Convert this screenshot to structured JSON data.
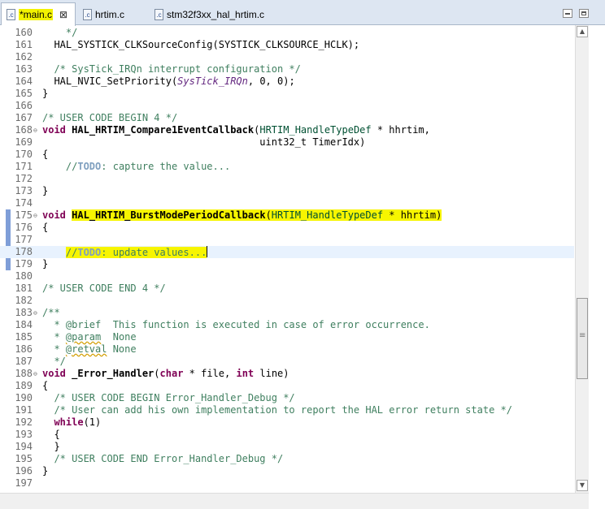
{
  "tabs": [
    {
      "label": "*main.c",
      "icon": "c-file-icon",
      "active": true
    },
    {
      "label": "hrtim.c",
      "icon": "c-file-icon",
      "active": false
    },
    {
      "label": "stm32f3xx_hal_hrtim.c",
      "icon": "c-file-icon",
      "active": false
    }
  ],
  "icon_text": ".c",
  "close_glyph": "⊠",
  "window_controls": [
    "minimize-icon",
    "maximize-icon"
  ],
  "scroll": {
    "up": "▲",
    "down": "▼",
    "thumb_fraction": 0.72
  },
  "colors": {
    "keyword": "#7f0055",
    "comment": "#3f7f5f",
    "highlight": "#f7f500",
    "current_line": "#e8f2fe",
    "change_bar": "#7f9ed8"
  },
  "editor": {
    "lines": [
      {
        "n": "160",
        "fold": "",
        "text": "    */"
      },
      {
        "n": "161",
        "fold": "",
        "text": "  HAL_SYSTICK_CLKSourceConfig(SYSTICK_CLKSOURCE_HCLK);"
      },
      {
        "n": "162",
        "fold": "",
        "text": ""
      },
      {
        "n": "163",
        "fold": "",
        "text": "  /* SysTick_IRQn interrupt configuration */"
      },
      {
        "n": "164",
        "fold": "",
        "text": "  HAL_NVIC_SetPriority(SysTick_IRQn, 0, 0);"
      },
      {
        "n": "165",
        "fold": "",
        "text": "}"
      },
      {
        "n": "166",
        "fold": "",
        "text": ""
      },
      {
        "n": "167",
        "fold": "",
        "text": "/* USER CODE BEGIN 4 */"
      },
      {
        "n": "168",
        "fold": "⊖",
        "text": "void HAL_HRTIM_Compare1EventCallback(HRTIM_HandleTypeDef * hhrtim,"
      },
      {
        "n": "169",
        "fold": "",
        "text": "                                     uint32_t TimerIdx)"
      },
      {
        "n": "170",
        "fold": "",
        "text": "{"
      },
      {
        "n": "171",
        "fold": "",
        "text": "    //TODO: capture the value..."
      },
      {
        "n": "172",
        "fold": "",
        "text": ""
      },
      {
        "n": "173",
        "fold": "",
        "text": "}"
      },
      {
        "n": "174",
        "fold": "",
        "text": ""
      },
      {
        "n": "175",
        "fold": "⊖",
        "text": "void HAL_HRTIM_BurstModePeriodCallback(HRTIM_HandleTypeDef * hhrtim)"
      },
      {
        "n": "176",
        "fold": "",
        "text": "{"
      },
      {
        "n": "177",
        "fold": "",
        "text": ""
      },
      {
        "n": "178",
        "fold": "",
        "text": "    //TODO: update values..."
      },
      {
        "n": "179",
        "fold": "",
        "text": "}"
      },
      {
        "n": "180",
        "fold": "",
        "text": ""
      },
      {
        "n": "181",
        "fold": "",
        "text": "/* USER CODE END 4 */"
      },
      {
        "n": "182",
        "fold": "",
        "text": ""
      },
      {
        "n": "183",
        "fold": "⊖",
        "text": "/**"
      },
      {
        "n": "184",
        "fold": "",
        "text": "  * @brief  This function is executed in case of error occurrence."
      },
      {
        "n": "185",
        "fold": "",
        "text": "  * @param  None"
      },
      {
        "n": "186",
        "fold": "",
        "text": "  * @retval None"
      },
      {
        "n": "187",
        "fold": "",
        "text": "  */"
      },
      {
        "n": "188",
        "fold": "⊖",
        "text": "void _Error_Handler(char * file, int line)"
      },
      {
        "n": "189",
        "fold": "",
        "text": "{"
      },
      {
        "n": "190",
        "fold": "",
        "text": "  /* USER CODE BEGIN Error_Handler_Debug */"
      },
      {
        "n": "191",
        "fold": "",
        "text": "  /* User can add his own implementation to report the HAL error return state */"
      },
      {
        "n": "192",
        "fold": "",
        "text": "  while(1)"
      },
      {
        "n": "193",
        "fold": "",
        "text": "  {"
      },
      {
        "n": "194",
        "fold": "",
        "text": "  }"
      },
      {
        "n": "195",
        "fold": "",
        "text": "  /* USER CODE END Error_Handler_Debug */"
      },
      {
        "n": "196",
        "fold": "",
        "text": "}"
      },
      {
        "n": "197",
        "fold": "",
        "text": ""
      }
    ]
  }
}
